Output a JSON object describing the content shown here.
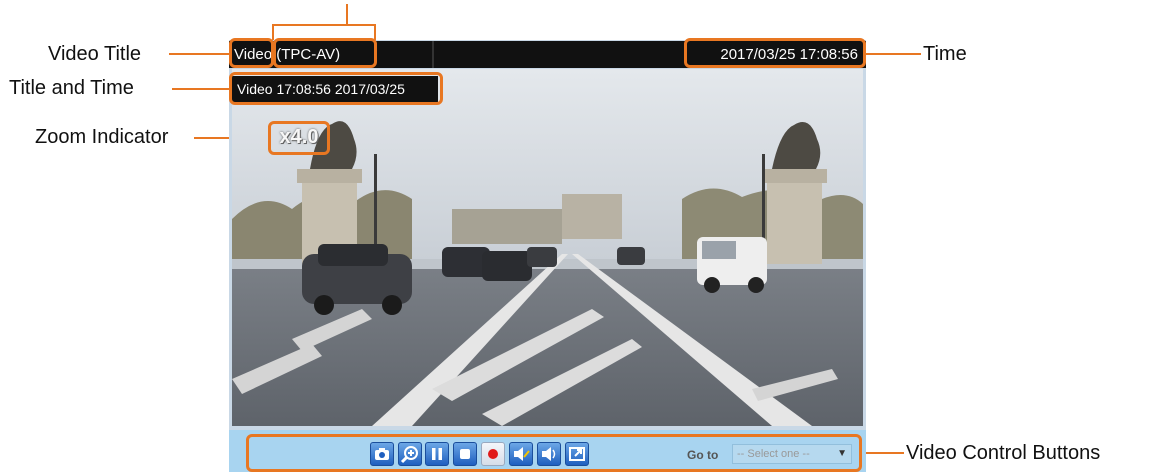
{
  "callouts": {
    "video_title": "Video Title",
    "title_and_time": "Title and Time",
    "zoom_indicator": "Zoom Indicator",
    "time": "Time",
    "video_control_buttons": "Video Control Buttons"
  },
  "viewer": {
    "video_title": "Video (TPC-AV)",
    "timestamp": "2017/03/25  17:08:56",
    "osd_text": "Video 17:08:56  2017/03/25",
    "zoom_text": "x4.0",
    "goto_label": "Go to",
    "goto_selected": "-- Select one --"
  },
  "controls": [
    {
      "name": "snapshot-icon"
    },
    {
      "name": "digital-zoom-icon"
    },
    {
      "name": "pause-icon"
    },
    {
      "name": "stop-icon"
    },
    {
      "name": "record-icon"
    },
    {
      "name": "mute-icon"
    },
    {
      "name": "volume-icon"
    },
    {
      "name": "fullscreen-icon"
    }
  ],
  "colors": {
    "callout_accent": "#e87722",
    "control_bar": "#a8d4f0",
    "title_bar": "#111111"
  }
}
